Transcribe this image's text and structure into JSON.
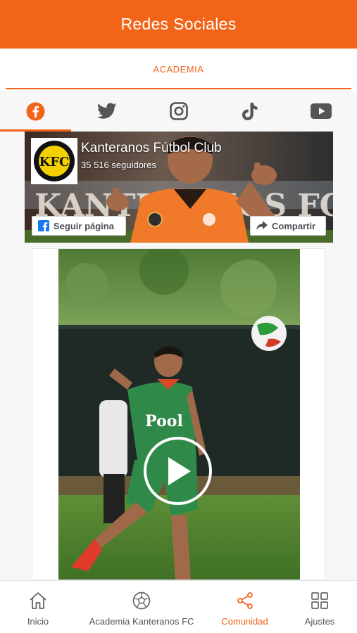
{
  "header": {
    "title": "Redes Sociales"
  },
  "subtabs": {
    "active_label": "ACADEMIA"
  },
  "social_tabs": [
    {
      "icon": "facebook-icon",
      "active": true
    },
    {
      "icon": "twitter-icon",
      "active": false
    },
    {
      "icon": "instagram-icon",
      "active": false
    },
    {
      "icon": "tiktok-icon",
      "active": false
    },
    {
      "icon": "youtube-icon",
      "active": false
    }
  ],
  "facebook_page": {
    "name": "Kanteranos Fútbol Club",
    "followers": "35 516 seguidores",
    "cover_text": "KANTERANOS FC",
    "logo_text": "KFC",
    "follow_label": "Seguir página",
    "share_label": "Compartir"
  },
  "post": {
    "jersey_text": "Pool",
    "media": "video",
    "play_icon": "play-icon"
  },
  "bottom_nav": [
    {
      "label": "Inicio",
      "icon": "home-icon",
      "active": false
    },
    {
      "label": "Academia Kanteranos FC",
      "icon": "soccer-ball-icon",
      "active": false
    },
    {
      "label": "Comunidad",
      "icon": "share-icon",
      "active": true
    },
    {
      "label": "Ajustes",
      "icon": "grid-icon",
      "active": false
    }
  ],
  "colors": {
    "accent": "#f26418",
    "facebook": "#1877f2"
  }
}
